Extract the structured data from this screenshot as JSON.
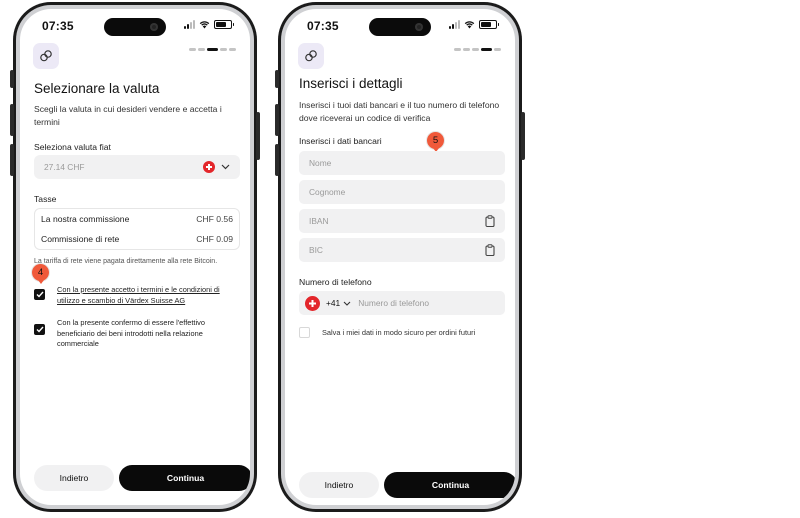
{
  "status": {
    "time": "07:35"
  },
  "screen1": {
    "title": "Selezionare la valuta",
    "subtitle": "Scegli la valuta in cui desideri vendere e accetta i termini",
    "fiat_label": "Seleziona valuta fiat",
    "fiat_value": "27.14 CHF",
    "fees_label": "Tasse",
    "fees": [
      {
        "name": "La nostra commissione",
        "amount": "CHF 0.56"
      },
      {
        "name": "Commissione di rete",
        "amount": "CHF 0.09"
      }
    ],
    "network_note": "La tariffa di rete viene pagata direttamente alla rete Bitcoin.",
    "terms_text": "Con la presente accetto i termini e le condizioni di utilizzo e scambio di Värdex Suisse AG",
    "beneficiary_text": "Con la presente confermo di essere l'effettivo beneficiario dei beni introdotti nella relazione commerciale",
    "back_label": "Indietro",
    "continue_label": "Continua",
    "marker": "4"
  },
  "screen2": {
    "title": "Inserisci i dettagli",
    "subtitle": "Inserisci i tuoi dati bancari e il tuo numero di telefono dove riceverai un codice di verifica",
    "bank_label": "Inserisci i dati bancari",
    "name_placeholder": "Nome",
    "surname_placeholder": "Cognome",
    "iban_placeholder": "IBAN",
    "bic_placeholder": "BIC",
    "phone_label": "Numero di telefono",
    "country_code": "+41",
    "phone_placeholder": "Numero di telefono",
    "save_text": "Salva i miei dati in modo sicuro per ordini futuri",
    "back_label": "Indietro",
    "continue_label": "Continua",
    "marker": "5"
  },
  "colors": {
    "accent": "#0a0a0a",
    "swiss_red": "#e3262b",
    "marker": "#f0593a",
    "field_bg": "#f1f1f2"
  }
}
